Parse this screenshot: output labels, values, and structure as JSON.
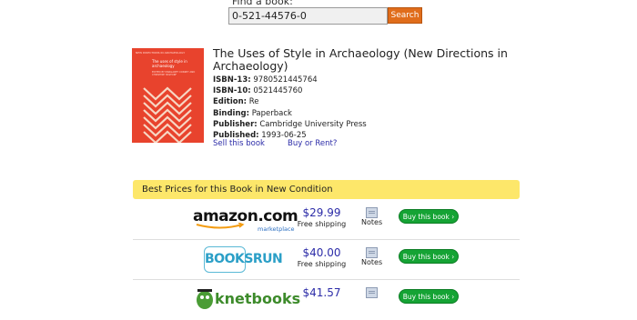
{
  "search": {
    "label": "Find a book:",
    "value": "0-521-44576-0",
    "button_label": "Search"
  },
  "book": {
    "title": "The Uses of Style in Archaeology (New Directions in Archaeology)",
    "cover": {
      "series": "NEW DIRECTIONS IN ARCHAEOLOGY",
      "title": "The uses of style in archaeology",
      "editors": "EDITED BY MARGARET CONKEY AND CHRISTINE HASTORF",
      "background_color": "#e8432d"
    },
    "details": [
      {
        "label": "ISBN-13:",
        "value": "9780521445764"
      },
      {
        "label": "ISBN-10:",
        "value": "0521445760"
      },
      {
        "label": "Edition:",
        "value": "Re"
      },
      {
        "label": "Binding:",
        "value": "Paperback"
      },
      {
        "label": "Publisher:",
        "value": "Cambridge University Press"
      },
      {
        "label": "Published:",
        "value": "1993-06-25"
      }
    ],
    "links": {
      "sell": "Sell this book",
      "buy_or_rent": "Buy or Rent?"
    }
  },
  "prices": {
    "heading": "Best Prices for this Book in New Condition",
    "offers": [
      {
        "vendor": "amazon.com marketplace",
        "logo_text": "amazon.com",
        "logo_sub": "marketplace",
        "price": "$29.99",
        "shipping": "Free shipping",
        "notes_label": "Notes",
        "button_label": "Buy this book ›"
      },
      {
        "vendor": "BooksRun",
        "logo_text": "BOOKSRUN",
        "price": "$40.00",
        "shipping": "Free shipping",
        "notes_label": "Notes",
        "button_label": "Buy this book ›"
      },
      {
        "vendor": "knetbooks",
        "logo_text": "knetbooks",
        "price": "$41.57",
        "shipping": "",
        "notes_label": "",
        "button_label": "Buy this book ›"
      }
    ]
  },
  "colors": {
    "search_button": "#e06d1b",
    "prices_bar": "#fde76a",
    "buy_button": "#15a334",
    "link": "#2c2ca8"
  }
}
